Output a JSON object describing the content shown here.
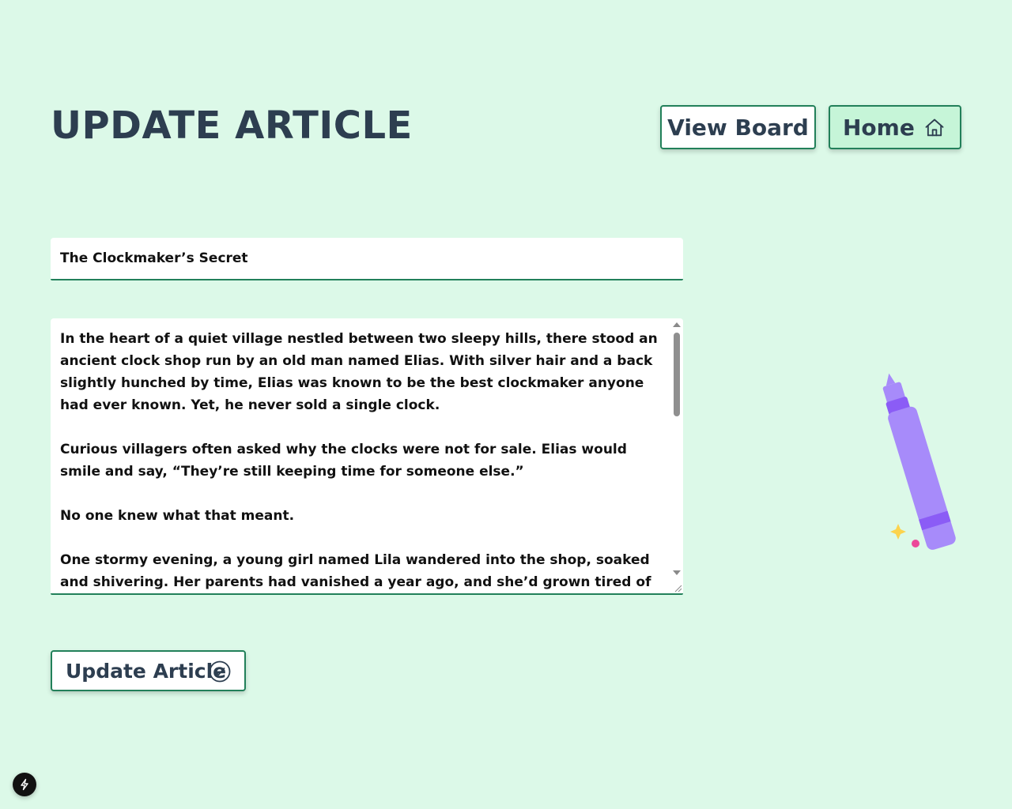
{
  "header": {
    "title": "UPDATE ARTICLE",
    "view_board_label": "View Board",
    "home_label": "Home"
  },
  "form": {
    "title_value": "The Clockmaker’s Secret",
    "body_value": "In the heart of a quiet village nestled between two sleepy hills, there stood an ancient clock shop run by an old man named Elias. With silver hair and a back slightly hunched by time, Elias was known to be the best clockmaker anyone had ever known. Yet, he never sold a single clock.\n\nCurious villagers often asked why the clocks were not for sale. Elias would smile and say, “They’re still keeping time for someone else.”\n\nNo one knew what that meant.\n\nOne stormy evening, a young girl named Lila wandered into the shop, soaked and shivering. Her parents had vanished a year ago, and she’d grown tired of waiting for",
    "submit_label": "Update Article"
  },
  "icons": {
    "home": "home-icon",
    "check": "check-circle-icon",
    "marker": "highlighter-marker-illustration",
    "dev_badge": "bolt-icon"
  },
  "colors": {
    "background": "#dcf9e8",
    "accent": "#22805a",
    "home_button_bg": "#c6f5d8",
    "text": "#2d3e50",
    "marker": "#a78bfa"
  }
}
